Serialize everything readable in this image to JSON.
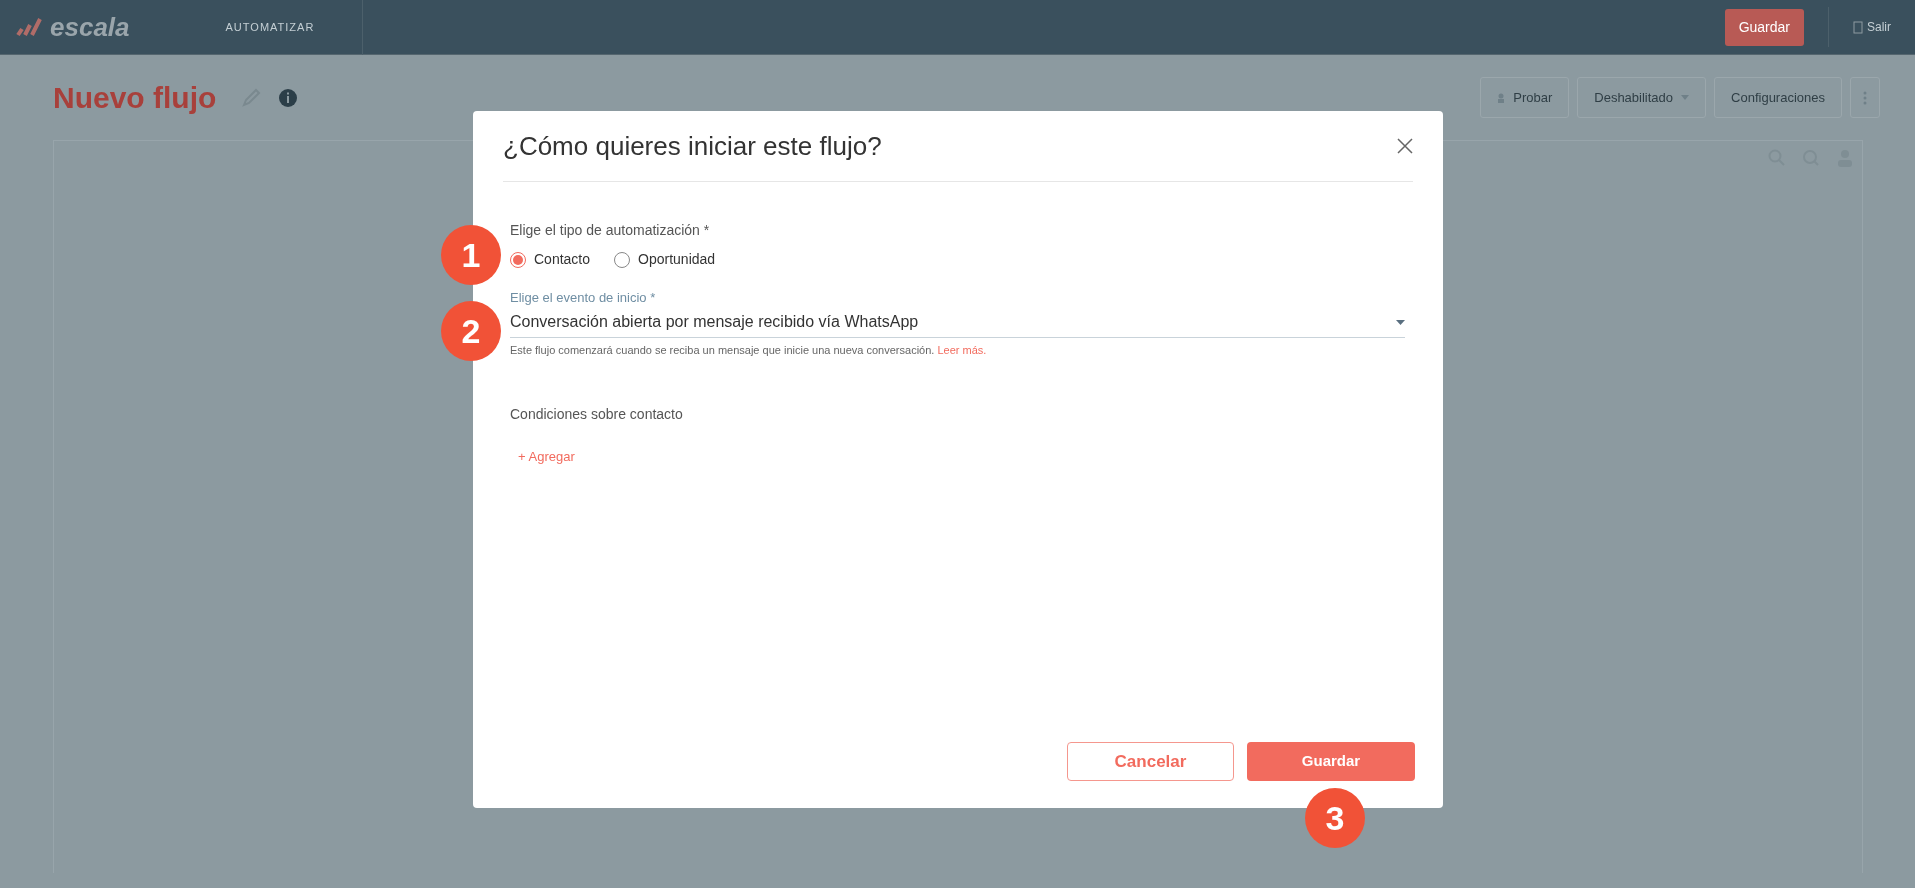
{
  "topbar": {
    "logo": "escala",
    "section": "AUTOMATIZAR",
    "save": "Guardar",
    "exit": "Salir"
  },
  "header": {
    "title": "Nuevo flujo",
    "buttons": [
      {
        "label": "Probar",
        "kind": "icon"
      },
      {
        "label": "Deshabilitado",
        "kind": "dropdown"
      },
      {
        "label": "Configuraciones",
        "kind": "plain"
      }
    ]
  },
  "modal": {
    "title": "¿Cómo quieres iniciar este flujo?",
    "type_label": "Elige el tipo de automatización *",
    "options": [
      {
        "label": "Contacto",
        "selected": true
      },
      {
        "label": "Oportunidad",
        "selected": false
      }
    ],
    "event_label": "Elige el evento de inicio *",
    "event_value": "Conversación abierta por mensaje recibido vía WhatsApp",
    "help": "Este flujo comenzará cuando se reciba un mensaje que inicie una nueva conversación.",
    "help_link": "Leer más.",
    "conditions_label": "Condiciones sobre contacto",
    "add": "+ Agregar",
    "cancel": "Cancelar",
    "save": "Guardar"
  },
  "steps": [
    "1",
    "2",
    "3"
  ]
}
